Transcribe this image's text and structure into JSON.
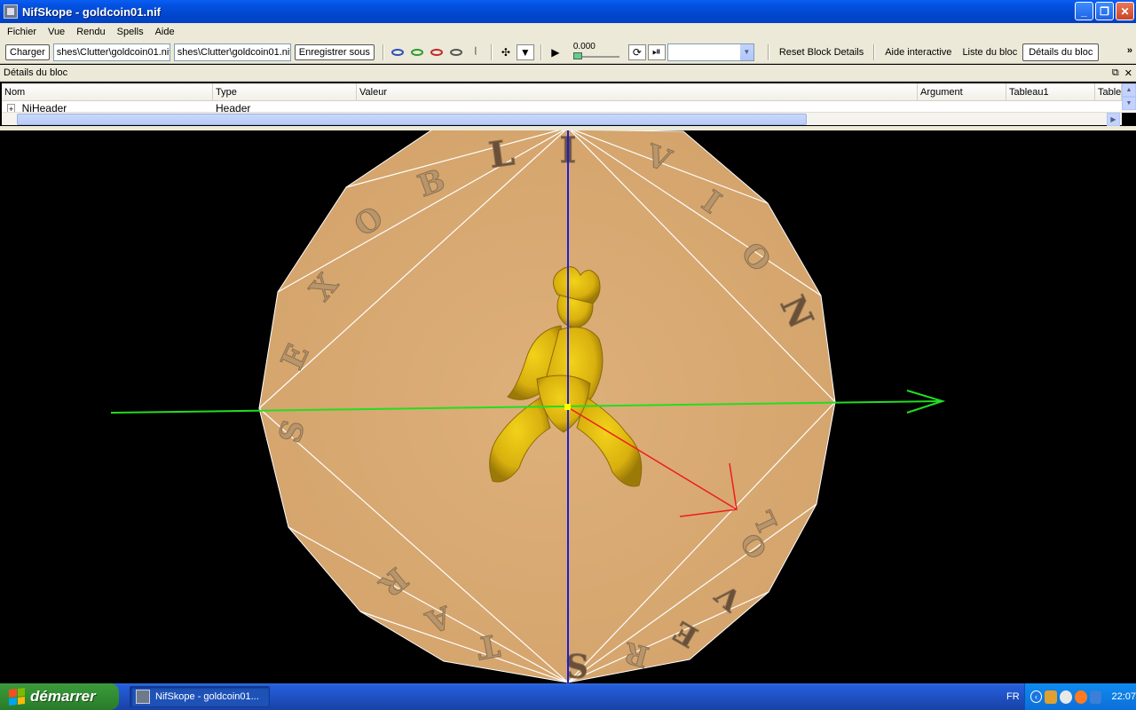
{
  "window": {
    "title": "NifSkope - goldcoin01.nif"
  },
  "menu": [
    "Fichier",
    "Vue",
    "Rendu",
    "Spells",
    "Aide"
  ],
  "toolbar": {
    "load_label": "Charger",
    "path_load": "shes\\Clutter\\goldcoin01.nif",
    "path_save": "shes\\Clutter\\goldcoin01.nif",
    "save_label": "Enregistrer sous",
    "anim_time": "0.000",
    "anim_progress": 0.0,
    "reset_block_details": "Reset Block Details",
    "help_label": "Aide interactive",
    "block_list_label": "Liste du bloc",
    "block_details_label": "Détails du bloc",
    "eye_colors": [
      "#2a4fbf",
      "#2f9a2f",
      "#c02a2a",
      "#555555"
    ]
  },
  "panel": {
    "title": "Détails du bloc",
    "columns": [
      "Nom",
      "Type",
      "Valeur",
      "Argument",
      "Tableau1",
      "Table"
    ],
    "row": {
      "name": "NiHeader",
      "type": "Header"
    }
  },
  "viewport": {
    "coin_color": "#d8a970",
    "letters_top": [
      "L",
      "I"
    ],
    "letters_left": [
      "S",
      "E",
      "X",
      "O",
      "B"
    ],
    "letters_right": [
      "V",
      "I",
      "O",
      "N"
    ],
    "letters_bottom": [
      "L",
      "O",
      "V",
      "E",
      "R",
      "S"
    ],
    "letters_bottom_left": [
      "R",
      "A",
      "T",
      "S"
    ]
  },
  "taskbar": {
    "start_label": "démarrer",
    "task_label": "NifSkope - goldcoin01...",
    "lang": "FR",
    "clock": "22:07"
  }
}
